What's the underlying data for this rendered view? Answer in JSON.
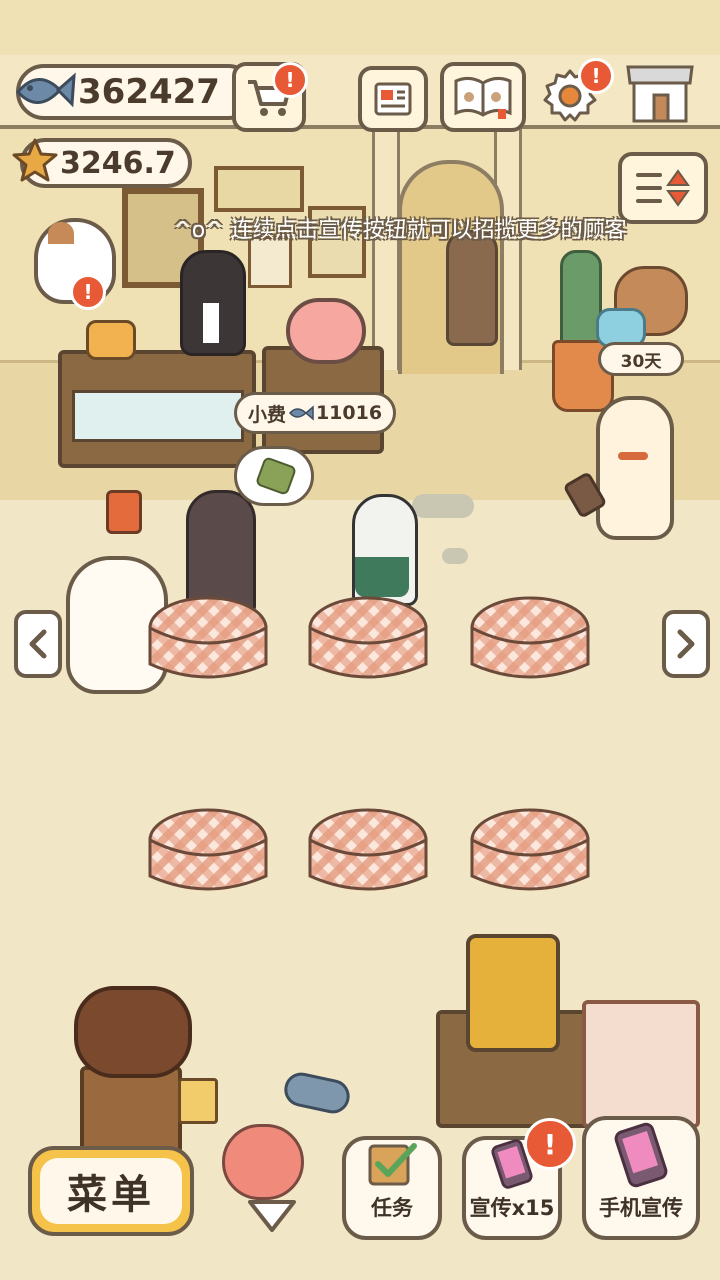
{
  "hud": {
    "fish_count": "362427",
    "star_count": "3246.7",
    "alert_mark": "!"
  },
  "hint_text": "^o^ 连续点击宣传按钮就可以招揽更多的顾客",
  "tip_bubble": {
    "label": "小费",
    "amount": "11016"
  },
  "timer_label": "30天",
  "icons": {
    "fish": "fish-icon",
    "star": "star-icon",
    "cart": "cart-icon",
    "news": "newspaper-icon",
    "book": "paw-book-icon",
    "gear": "gear-icon",
    "shop": "shop-icon",
    "sort": "sort-icon"
  },
  "buttons": {
    "menu": "菜单",
    "tasks": "任务",
    "promote": "宣传x15",
    "phone_promote": "手机宣传"
  },
  "colors": {
    "accent": "#e85a35",
    "outline": "#6b5b49",
    "menu_button": "#f6c34a",
    "tablecloth": "#e59b7f"
  }
}
